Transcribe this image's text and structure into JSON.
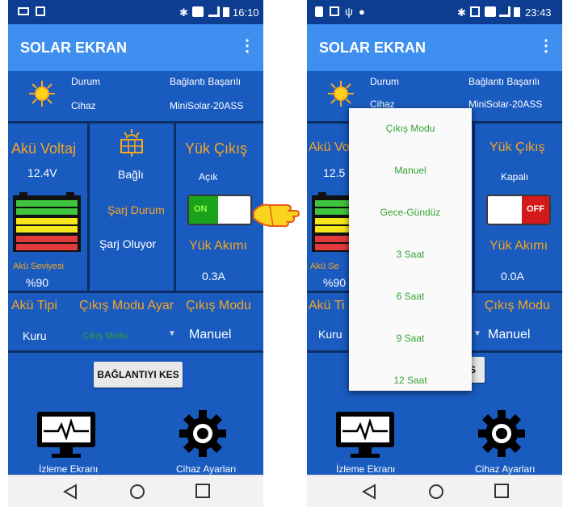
{
  "left": {
    "status_time": "16:10",
    "app_title": "SOLAR EKRAN",
    "info": {
      "durum_label": "Durum",
      "durum_value": "Bağlantı Başarılı",
      "cihaz_label": "Cihaz",
      "cihaz_value": "MiniSolar-20ASS"
    },
    "akue_voltaj_title": "Akü Voltaj",
    "akue_voltaj_value": "12.4V",
    "akue_seviyesi_label": "Akü Seviyesi",
    "akue_seviyesi_value": "%90",
    "panel_status": "Bağlı",
    "sarj_durum_title": "Şarj Durum",
    "sarj_durum_value": "Şarj Oluyor",
    "yuk_cikis_title": "Yük Çıkış",
    "yuk_cikis_value": "Açık",
    "switch_label": "ON",
    "yuk_akimi_title": "Yük Akımı",
    "yuk_akimi_value": "0.3A",
    "aku_tipi_title": "Akü Tipi",
    "aku_tipi_value": "Kuru",
    "cikis_modu_ayar_title": "Çıkış Modu Ayar",
    "cikis_modu_ayar_placeholder": "Çıkış Modu",
    "cikis_modu_title": "Çıkış Modu",
    "cikis_modu_value": "Manuel",
    "disconnect_button": "BAĞLANTIYI KES",
    "izleme_label": "İzleme Ekranı",
    "cihaz_ayarlari_label": "Cihaz Ayarları"
  },
  "right": {
    "status_time": "23:43",
    "app_title": "SOLAR EKRAN",
    "info": {
      "durum_label": "Durum",
      "durum_value": "Bağlantı Başarılı",
      "cihaz_label": "Cihaz",
      "cihaz_value": "MiniSolar-20ASS"
    },
    "akue_voltaj_title": "Akü Vo",
    "akue_voltaj_value": "12.5",
    "akue_seviyesi_label": "Akü Se",
    "akue_seviyesi_value": "%90",
    "yuk_cikis_title": "Yük Çıkış",
    "yuk_cikis_value": "Kapalı",
    "switch_label": "OFF",
    "yuk_akimi_title": "Yük Akımı",
    "yuk_akimi_value": "0.0A",
    "aku_tipi_title": "Akü Ti",
    "aku_tipi_value": "Kuru",
    "cikis_modu_title": "Çıkış Modu",
    "cikis_modu_value": "Manuel",
    "disconnect_button_partial": "S",
    "izleme_label": "İzleme Ekranı",
    "cihaz_ayarlari_label": "Cihaz Ayarları",
    "dropdown_options": [
      "Çıkış Modu",
      "Manuel",
      "Gece-Gündüz",
      "3 Saat",
      "6 Saat",
      "9 Saat",
      "12 Saat"
    ]
  },
  "colors": {
    "background": "#1a5bc0",
    "appbar": "#3e8ff0",
    "statusbar": "#0c3d91",
    "accent_orange": "#f7a620",
    "accent_green": "#35a233",
    "switch_on": "#1aa31a",
    "switch_off": "#d21a1a"
  }
}
